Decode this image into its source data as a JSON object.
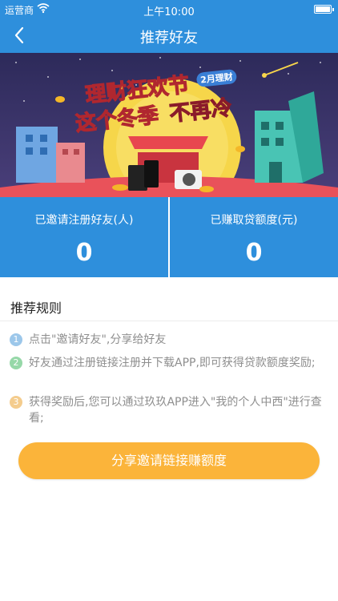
{
  "status_bar": {
    "carrier": "运营商",
    "time": "上午10:00"
  },
  "nav": {
    "title": "推荐好友"
  },
  "banner": {
    "headline_line1": "理财狂欢节",
    "headline_line2_a": "这个冬季",
    "headline_line2_b": "不再冷",
    "tag": "2月理财"
  },
  "stats": [
    {
      "label": "已邀请注册好友(人)",
      "value": "0"
    },
    {
      "label": "已赚取贷额度(元)",
      "value": "0"
    }
  ],
  "rules": {
    "title": "推荐规则",
    "items": [
      {
        "num": "1",
        "text": "点击\"邀请好友\",分享给好友"
      },
      {
        "num": "2",
        "text": "好友通过注册链接注册并下载APP,即可获得贷款额度奖励;"
      },
      {
        "num": "3",
        "text": "获得奖励后,您可以通过玖玖APP进入\"我的个人中西\"进行查看;"
      }
    ]
  },
  "share_button": {
    "label": "分享邀请链接赚额度"
  },
  "colors": {
    "primary": "#2e8fdc",
    "button": "#fbb43a",
    "rule_text": "#8e8e8e"
  }
}
